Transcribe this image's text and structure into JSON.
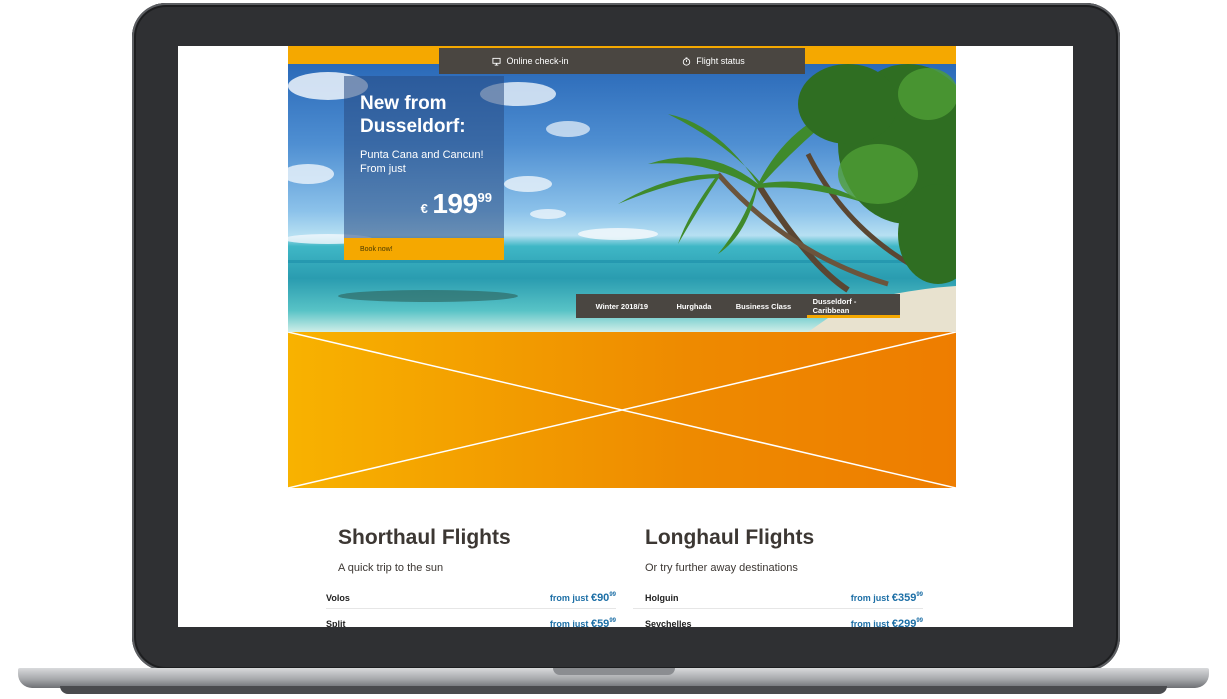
{
  "service_bar": {
    "checkin_label": "Online check-in",
    "status_label": "Flight status"
  },
  "promo": {
    "title": "New from Dusseldorf:",
    "subtitle": "Punta Cana and Cancun! From just",
    "price_currency": "€",
    "price_main": "199",
    "price_cents": "99",
    "cta": "Book now!"
  },
  "tabs": [
    {
      "label": "Winter 2018/19",
      "active": false
    },
    {
      "label": "Hurghada",
      "active": false
    },
    {
      "label": "Business Class",
      "active": false
    },
    {
      "label": "Dusseldorf - Caribbean",
      "active": true
    }
  ],
  "shorthaul": {
    "title": "Shorthaul Flights",
    "subtitle": "A quick trip to the sun",
    "rows": [
      {
        "destination": "Volos",
        "prefix": "from just",
        "currency": "€",
        "amount": "90",
        "cents": "99"
      },
      {
        "destination": "Split",
        "prefix": "from just",
        "currency": "€",
        "amount": "59",
        "cents": "99"
      }
    ]
  },
  "longhaul": {
    "title": "Longhaul Flights",
    "subtitle": "Or try further away destinations",
    "rows": [
      {
        "destination": "Holguin",
        "prefix": "from just",
        "currency": "€",
        "amount": "359",
        "cents": "99"
      },
      {
        "destination": "Seychelles",
        "prefix": "from just",
        "currency": "€",
        "amount": "299",
        "cents": "99"
      }
    ]
  },
  "colors": {
    "brand_orange": "#f5a800",
    "bar_dark": "#4a4641",
    "price_blue": "#1d6fa6"
  },
  "icons": [
    "computer-icon",
    "clock-icon"
  ]
}
